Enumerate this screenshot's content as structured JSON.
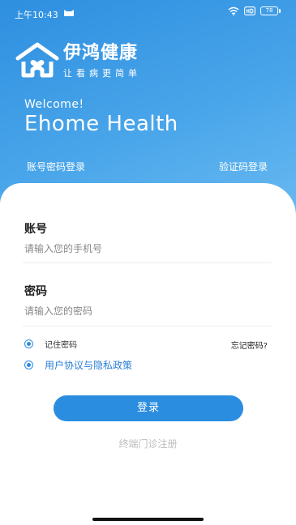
{
  "status_bar": {
    "time": "上午10:43",
    "battery": "78",
    "icons": [
      "cat-icon",
      "wifi-icon",
      "hd-icon",
      "battery-icon"
    ]
  },
  "brand": {
    "name": "伊鸿健康",
    "slogan": "让看病更简单",
    "icon": "house-heart-logo-icon"
  },
  "welcome": "Welcome!",
  "app_title": "Ehome Health",
  "tabs": {
    "password_login": "账号密码登录",
    "code_login": "验证码登录"
  },
  "form": {
    "account_label": "账号",
    "account_placeholder": "请输入您的手机号",
    "account_value": "",
    "password_label": "密码",
    "password_placeholder": "请输入您的密码",
    "password_value": "",
    "remember": "记住密码",
    "forgot": "忘记密码?",
    "agreement": "用户协议与隐私政策"
  },
  "login_button": "登录",
  "register_link": "终端门诊注册",
  "colors": {
    "gradient_start": "#2e8fe0",
    "gradient_end": "#6cbcf2",
    "accent": "#2b8de0",
    "link": "#2b7fd4",
    "muted": "#bdbdbd"
  }
}
